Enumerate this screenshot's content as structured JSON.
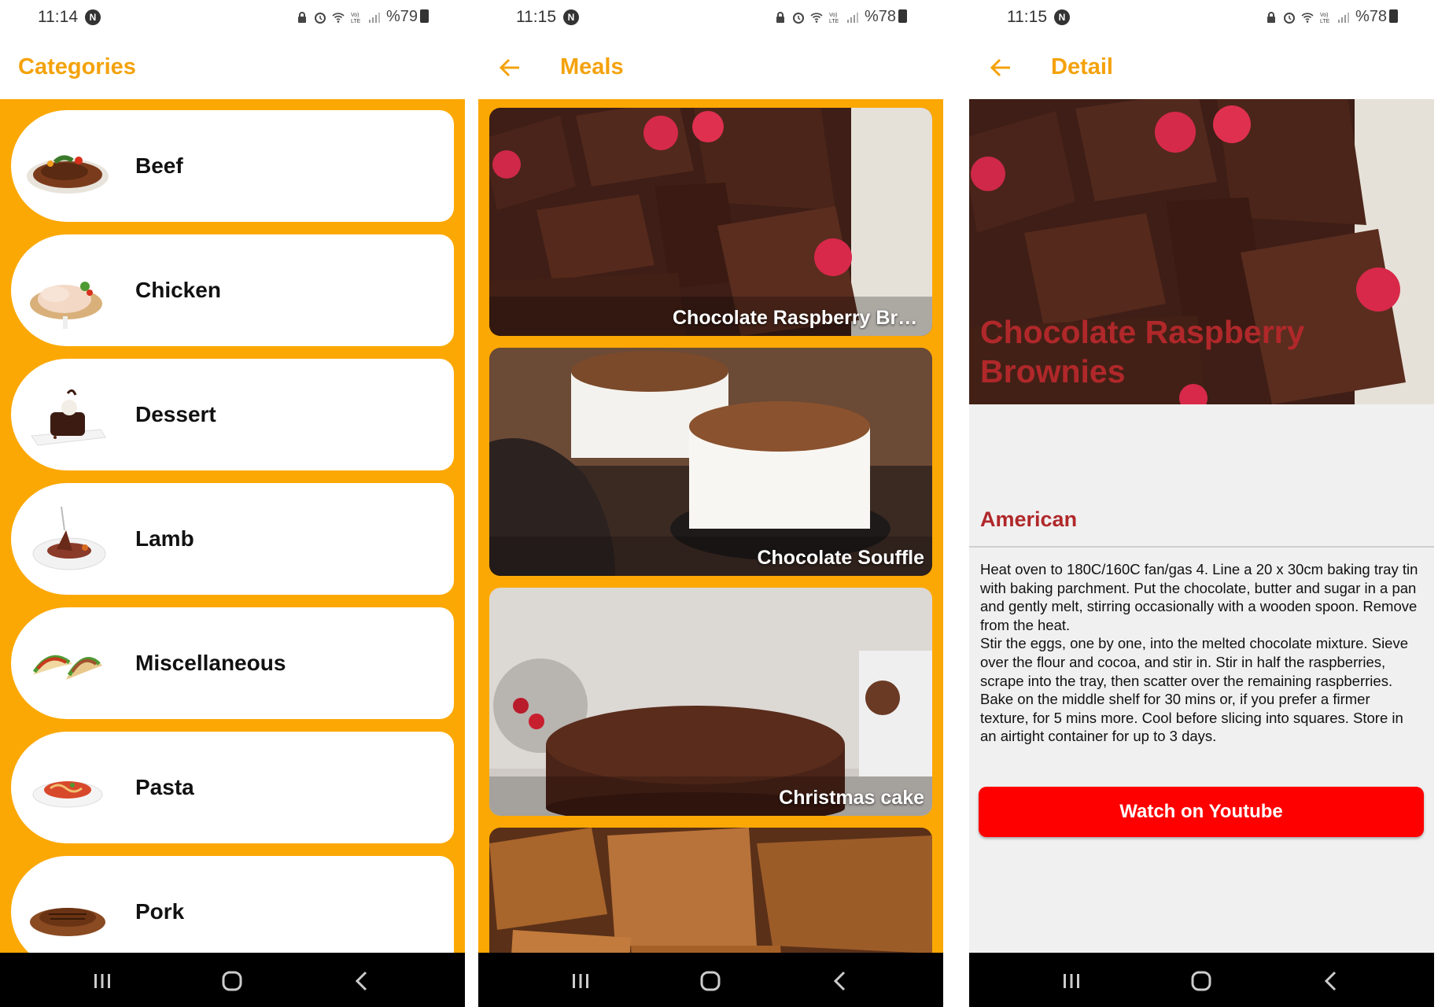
{
  "screens": [
    {
      "status": {
        "time": "11:14",
        "battery": "%79"
      },
      "appbar": {
        "title": "Categories"
      },
      "categories": [
        {
          "label": "Beef",
          "icon": "steak-plate-icon"
        },
        {
          "label": "Chicken",
          "icon": "chicken-plate-icon"
        },
        {
          "label": "Dessert",
          "icon": "dessert-plate-icon"
        },
        {
          "label": "Lamb",
          "icon": "lamb-plate-icon"
        },
        {
          "label": "Miscellaneous",
          "icon": "tacos-icon"
        },
        {
          "label": "Pasta",
          "icon": "pasta-plate-icon"
        },
        {
          "label": "Pork",
          "icon": "pork-plate-icon"
        }
      ]
    },
    {
      "status": {
        "time": "11:15",
        "battery": "%78"
      },
      "appbar": {
        "title": "Meals"
      },
      "meals": [
        {
          "label": "Chocolate Raspberry Brownies"
        },
        {
          "label": "Chocolate Souffle"
        },
        {
          "label": "Christmas cake"
        },
        {
          "label": ""
        }
      ]
    },
    {
      "status": {
        "time": "11:15",
        "battery": "%78"
      },
      "appbar": {
        "title": "Detail"
      },
      "detail": {
        "title": "Chocolate Raspberry Brownies",
        "area": "American",
        "instructions": "Heat oven to 180C/160C fan/gas 4. Line a 20 x 30cm baking tray tin with baking parchment. Put the chocolate, butter and sugar in a pan and gently melt, stirring occasionally with a wooden spoon. Remove from the heat.\nStir the eggs, one by one, into the melted chocolate mixture. Sieve over the flour and cocoa, and stir in. Stir in half the raspberries, scrape into the tray, then scatter over the remaining raspberries. Bake on the middle shelf for 30 mins or, if you prefer a firmer texture, for 5 mins more. Cool before slicing into squares. Store in an airtight container for up to 3 days.",
        "youtube_button": "Watch on Youtube"
      }
    }
  ],
  "colors": {
    "accent": "#f4a20c",
    "orange_bg": "#fca804",
    "title_red": "#b0282a",
    "youtube_red": "#ff0000",
    "navbar": "#000000"
  },
  "status_icons": [
    "lock-icon",
    "alarm-icon",
    "wifi-icon",
    "volte-icon",
    "signal-icon",
    "battery-icon"
  ],
  "nav_icons": [
    "recents-icon",
    "home-icon",
    "back-icon"
  ]
}
